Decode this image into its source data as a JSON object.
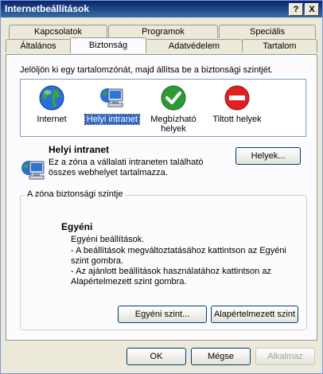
{
  "window": {
    "title": "Internetbeállítások",
    "help_glyph": "?",
    "close_glyph": "X"
  },
  "tabs": {
    "row1": [
      {
        "label": "Kapcsolatok"
      },
      {
        "label": "Programok"
      },
      {
        "label": "Speciális"
      }
    ],
    "row2": [
      {
        "label": "Általános"
      },
      {
        "label": "Biztonság",
        "active": true
      },
      {
        "label": "Adatvédelem"
      },
      {
        "label": "Tartalom"
      }
    ]
  },
  "instruction": "Jelöljön ki egy tartalomzónát, majd állítsa be a biztonsági szintjét.",
  "zones": [
    {
      "label": "Internet",
      "icon": "globe-icon"
    },
    {
      "label": "Helyi intranet",
      "icon": "computer-globe-icon",
      "selected": true
    },
    {
      "label": "Megbízható helyek",
      "icon": "green-check-icon"
    },
    {
      "label": "Tiltott helyek",
      "icon": "red-no-entry-icon"
    }
  ],
  "selected_zone": {
    "name": "Helyi intranet",
    "description": "Ez a zóna a vállalati intraneten található összes webhelyet tartalmazza."
  },
  "buttons": {
    "sites": "Helyek...",
    "custom_level": "Egyéni szint...",
    "default_level": "Alapértelmezett szint",
    "ok": "OK",
    "cancel": "Mégse",
    "apply": "Alkalmaz"
  },
  "security_group": {
    "title": "A zóna biztonsági szintje",
    "level_name": "Egyéni",
    "level_desc": "Egyéni beállítások.",
    "bullet1": "- A beállítások megváltoztatásához kattintson az Egyéni szint gombra.",
    "bullet2": "- Az ajánlott beállítások használatához kattintson az Alapértelmezett szint gombra."
  }
}
